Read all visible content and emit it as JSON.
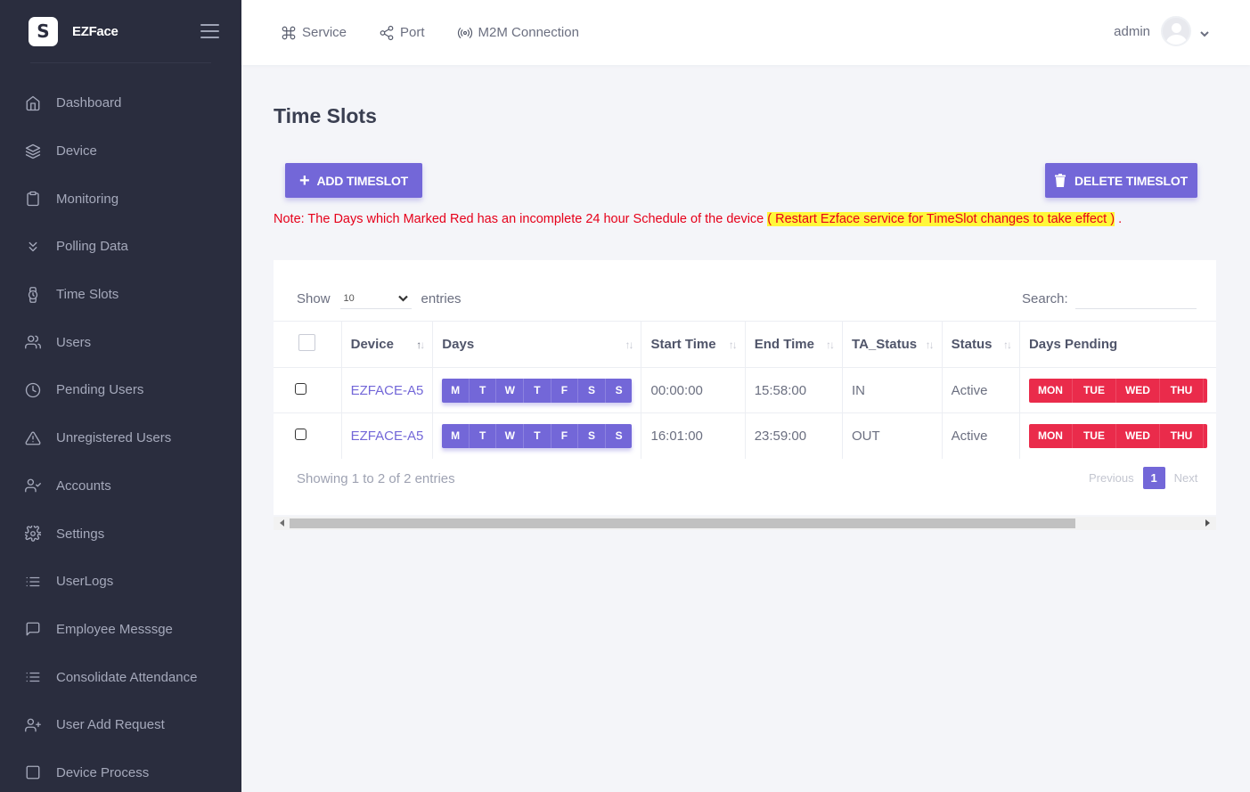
{
  "brand": {
    "name": "EZFace",
    "logo_letter": "S"
  },
  "sidebar": {
    "items": [
      {
        "label": "Dashboard",
        "icon": "home-icon"
      },
      {
        "label": "Device",
        "icon": "layers-icon"
      },
      {
        "label": "Monitoring",
        "icon": "clipboard-icon"
      },
      {
        "label": "Polling Data",
        "icon": "chevrons-down-icon"
      },
      {
        "label": "Time Slots",
        "icon": "watch-icon"
      },
      {
        "label": "Users",
        "icon": "users-icon"
      },
      {
        "label": "Pending Users",
        "icon": "clock-icon"
      },
      {
        "label": "Unregistered Users",
        "icon": "alert-triangle-icon"
      },
      {
        "label": "Accounts",
        "icon": "user-check-icon"
      },
      {
        "label": "Settings",
        "icon": "settings-icon"
      },
      {
        "label": "UserLogs",
        "icon": "list-icon"
      },
      {
        "label": "Employee Messsge",
        "icon": "message-square-icon"
      },
      {
        "label": "Consolidate Attendance",
        "icon": "list-icon"
      },
      {
        "label": "User Add Request",
        "icon": "user-plus-icon"
      },
      {
        "label": "Device Process",
        "icon": "square-icon"
      }
    ]
  },
  "topbar": {
    "links": [
      {
        "label": "Service",
        "icon": "command-icon"
      },
      {
        "label": "Port",
        "icon": "share-icon"
      },
      {
        "label": "M2M Connection",
        "icon": "broadcast-icon"
      }
    ],
    "user": "admin"
  },
  "page": {
    "title": "Time Slots",
    "add_button": "ADD TIMESLOT",
    "delete_button": "DELETE TIMESLOT",
    "note_main": "Note: The Days which Marked Red has an incomplete 24 hour Schedule of the device ",
    "note_highlight": "( Restart Ezface service for TimeSlot changes to take effect )",
    "note_end": " ."
  },
  "table": {
    "show_label": "Show",
    "entries_label": "entries",
    "page_length": "10",
    "search_label": "Search:",
    "columns": [
      "Device",
      "Days",
      "Start Time",
      "End Time",
      "TA_Status",
      "Status",
      "Days Pending"
    ],
    "day_labels": [
      "M",
      "T",
      "W",
      "T",
      "F",
      "S",
      "S"
    ],
    "pending_labels": [
      "MON",
      "TUE",
      "WED",
      "THU"
    ],
    "rows": [
      {
        "device": "EZFACE-A5",
        "start": "00:00:00",
        "end": "15:58:00",
        "ta_status": "IN",
        "status": "Active"
      },
      {
        "device": "EZFACE-A5",
        "start": "16:01:00",
        "end": "23:59:00",
        "ta_status": "OUT",
        "status": "Active"
      }
    ],
    "info": "Showing 1 to 2 of 2 entries",
    "pager": {
      "previous": "Previous",
      "current": "1",
      "next": "Next"
    }
  },
  "colors": {
    "sidebar_bg": "#2a2d3e",
    "accent": "#7367d8",
    "danger": "#ea2b4b",
    "note": "#e6001a",
    "highlight": "#fff83a"
  }
}
